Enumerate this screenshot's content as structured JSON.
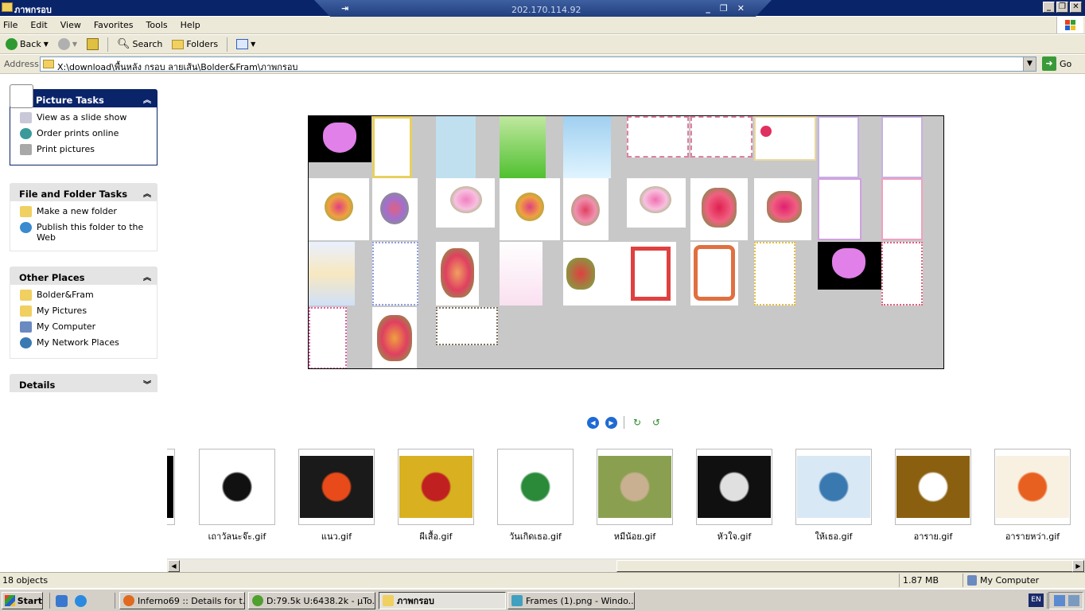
{
  "window": {
    "title": "ภาพกรอบ",
    "remote_ip": "202.170.114.92"
  },
  "menu": [
    "File",
    "Edit",
    "View",
    "Favorites",
    "Tools",
    "Help"
  ],
  "toolbar": {
    "back": "Back",
    "search": "Search",
    "folders": "Folders"
  },
  "address": {
    "label": "Address",
    "path": "X:\\download\\พื้นหลัง กรอบ ลายเส้น\\Bolder&Fram\\ภาพกรอบ",
    "go": "Go"
  },
  "panels": {
    "picture_tasks": {
      "title": "Picture Tasks",
      "items": [
        "View as a slide show",
        "Order prints online",
        "Print pictures"
      ]
    },
    "file_folder_tasks": {
      "title": "File and Folder Tasks",
      "items": [
        "Make a new folder",
        "Publish this folder to the Web"
      ]
    },
    "other_places": {
      "title": "Other Places",
      "items": [
        "Bolder&Fram",
        "My Pictures",
        "My Computer",
        "My Network Places"
      ]
    },
    "details": {
      "title": "Details"
    }
  },
  "filmstrip": [
    {
      "name": "เถาวัลนะจ๊ะ.gif",
      "color": "#ffffff",
      "accent": "#111111"
    },
    {
      "name": "แนว.gif",
      "color": "#1a1a1a",
      "accent": "#e84a1a"
    },
    {
      "name": "ผีเสื้อ.gif",
      "color": "#d8b020",
      "accent": "#c02020"
    },
    {
      "name": "วันเกิดเธอ.gif",
      "color": "#ffffff",
      "accent": "#2a8a3a"
    },
    {
      "name": "หมีน้อย.gif",
      "color": "#8aa050",
      "accent": "#c8b090"
    },
    {
      "name": "หัวใจ.gif",
      "color": "#101010",
      "accent": "#e0e0e0"
    },
    {
      "name": "ให้เธอ.gif",
      "color": "#d8e8f4",
      "accent": "#3a78b0"
    },
    {
      "name": "อาราย.gif",
      "color": "#8a6010",
      "accent": "#ffffff"
    },
    {
      "name": "อารายหว่า.gif",
      "color": "#f8f0e0",
      "accent": "#e86020"
    }
  ],
  "status": {
    "objects": "18 objects",
    "size": "1.87 MB",
    "location": "My Computer"
  },
  "taskbar": {
    "start": "Start",
    "tasks": [
      "Inferno69 :: Details for t...",
      "D:79.5k U:6438.2k - µTo...",
      "ภาพกรอบ",
      "Frames (1).png - Windo..."
    ],
    "language": "EN"
  },
  "colors": {
    "title_bar": "#0a246a",
    "panel_header": "#215dc6",
    "chrome": "#ece9d8"
  }
}
